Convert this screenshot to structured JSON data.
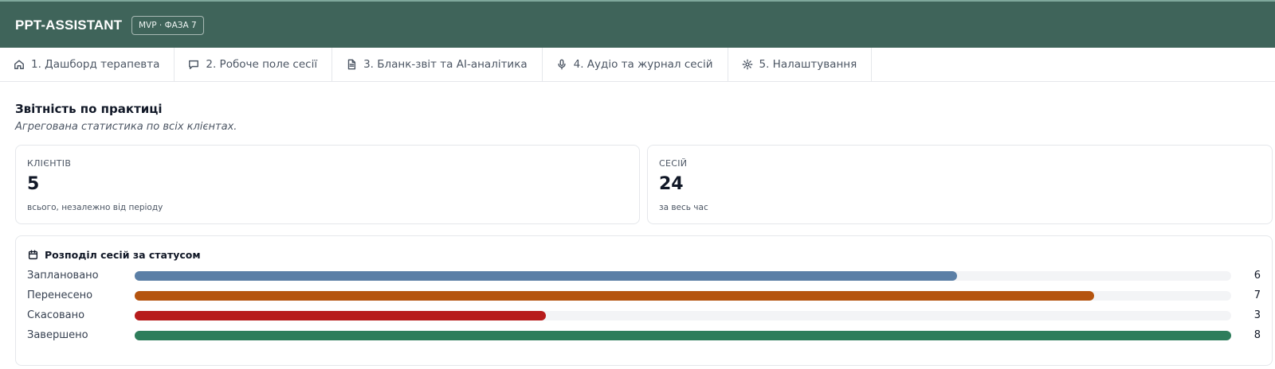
{
  "app": {
    "title": "PPT-ASSISTANT",
    "badge": "MVP · ФАЗА 7"
  },
  "tabs": [
    {
      "label": "1. Дашборд терапевта",
      "icon": "home-icon"
    },
    {
      "label": "2. Робоче поле сесії",
      "icon": "chat-icon"
    },
    {
      "label": "3. Бланк-звіт та AI-аналітика",
      "icon": "document-icon"
    },
    {
      "label": "4. Аудіо та журнал сесій",
      "icon": "microphone-icon"
    },
    {
      "label": "5. Налаштування",
      "icon": "gear-icon"
    }
  ],
  "report": {
    "title": "Звітність по практиці",
    "subtitle": "Агрегована статистика по всіх клієнтах."
  },
  "stats": [
    {
      "label": "КЛІЄНТІВ",
      "value": "5",
      "hint": "всього, незалежно від періоду"
    },
    {
      "label": "СЕСІЙ",
      "value": "24",
      "hint": "за весь час"
    }
  ],
  "distribution": {
    "title": "Розподіл сесій за статусом",
    "icon": "calendar-icon",
    "max": 8,
    "rows": [
      {
        "label": "Заплановано",
        "value": 6,
        "color": "#5b7fa6"
      },
      {
        "label": "Перенесено",
        "value": 7,
        "color": "#b5540f"
      },
      {
        "label": "Скасовано",
        "value": 3,
        "color": "#b71c1c"
      },
      {
        "label": "Завершено",
        "value": 8,
        "color": "#2e7d5b"
      }
    ]
  }
}
